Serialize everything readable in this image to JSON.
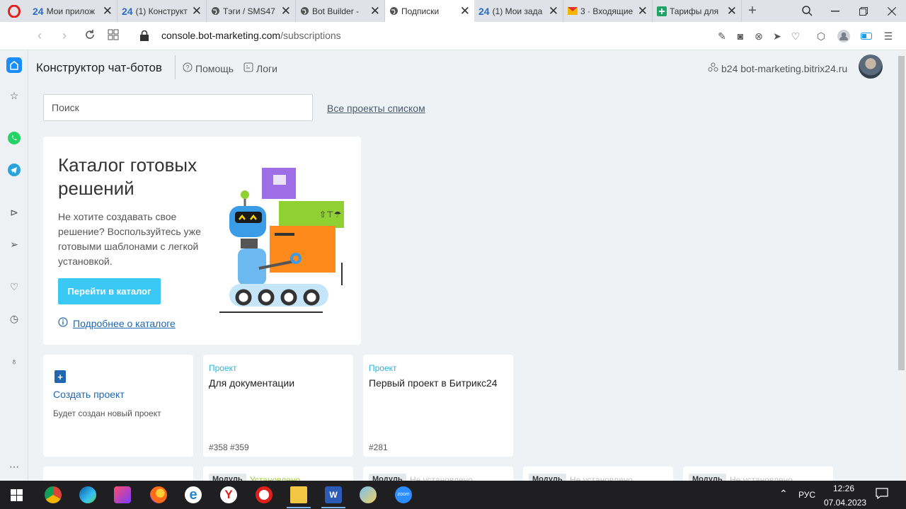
{
  "tabs": [
    {
      "favicon": "24",
      "title": "Мои прилож"
    },
    {
      "favicon": "24",
      "title": "(1) Конструкт"
    },
    {
      "favicon": "globe",
      "title": "Тэги / SMS47"
    },
    {
      "favicon": "globe",
      "title": "Bot Builder - "
    },
    {
      "favicon": "globe",
      "title": "Подписки"
    },
    {
      "favicon": "24",
      "title": "(1) Мои зада"
    },
    {
      "favicon": "mail",
      "title": "3 · Входящие"
    },
    {
      "favicon": "sheets",
      "title": "Тарифы для"
    }
  ],
  "address": {
    "domain": "console.bot-marketing.com",
    "path": "/subscriptions"
  },
  "header": {
    "title": "Конструктор чат-ботов",
    "help": "Помощь",
    "logs": "Логи",
    "portal": "b24 bot-marketing.bitrix24.ru"
  },
  "search": {
    "placeholder": "Поиск"
  },
  "all_projects_link": "Все проекты списком",
  "catalog": {
    "title": "Каталог готовых решений",
    "description": "Не хотите создавать свое решение? Воспользуйтесь уже готовыми шаблонами с легкой установкой.",
    "button": "Перейти в каталог",
    "more": "Подробнее о каталоге"
  },
  "create_card": {
    "title": "Создать проект",
    "subtitle": "Будет создан новый проект"
  },
  "projects": [
    {
      "type": "Проект",
      "name": "Для документации",
      "tags": "#358 #359"
    },
    {
      "type": "Проект",
      "name": "Первый проект в Битрикс24",
      "tags": "#281"
    }
  ],
  "modules": [
    {
      "badge": "",
      "status": ""
    },
    {
      "badge": "Модуль",
      "status": "Установлено"
    },
    {
      "badge": "Модуль",
      "status": "Не установлено"
    },
    {
      "badge": "Модуль",
      "status": "Не установлено"
    },
    {
      "badge": "Модуль",
      "status": "Не установлено"
    }
  ],
  "tray": {
    "lang": "РУС",
    "time": "12:26",
    "date": "07.04.2023"
  },
  "colors": {
    "accent": "#3bc8f5",
    "link": "#2067b0",
    "page_bg": "#eef2f4"
  }
}
